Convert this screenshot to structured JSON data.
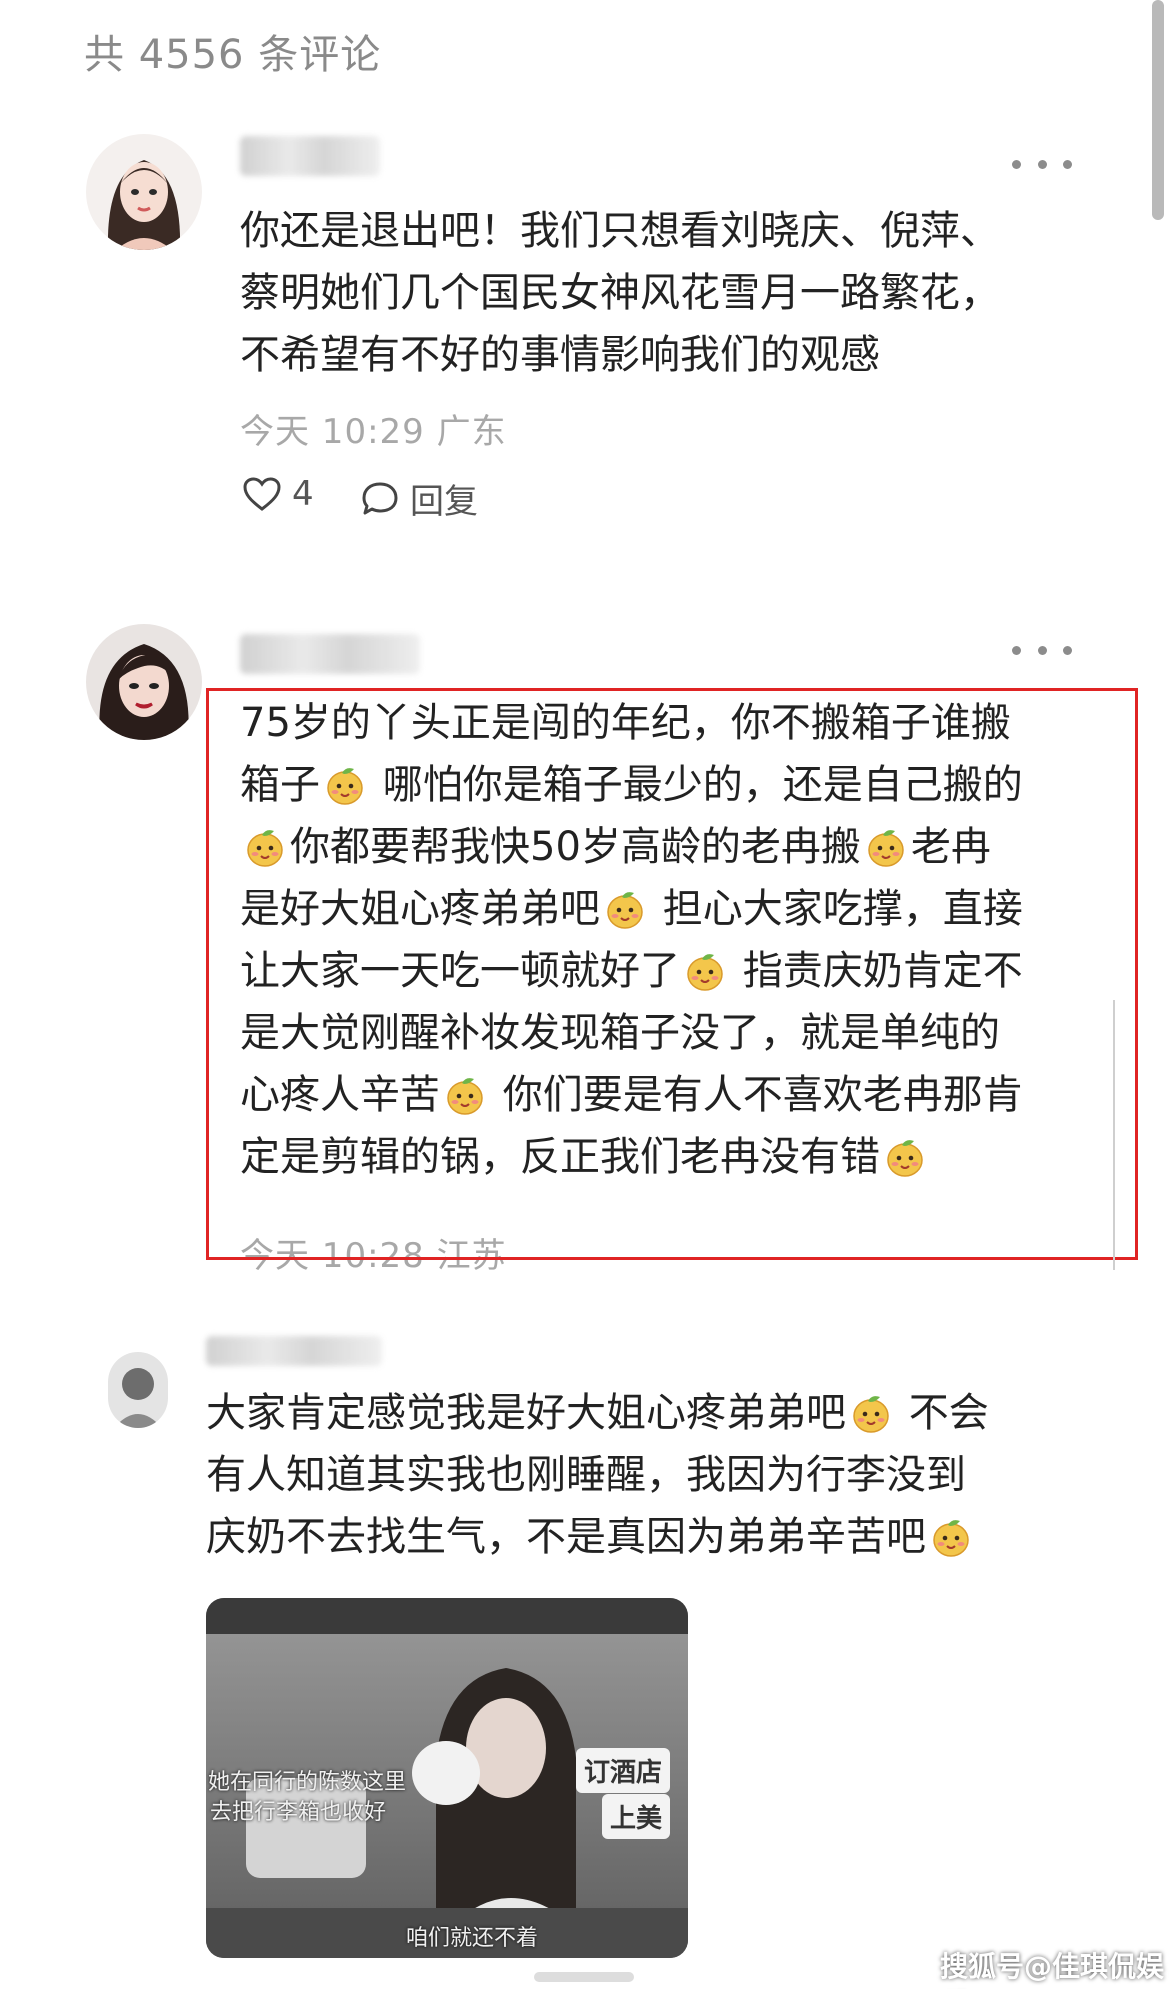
{
  "header": {
    "comment_count": "共 4556 条评论"
  },
  "comments": [
    {
      "text": "你还是退出吧！我们只想看刘晓庆、倪萍、蔡明她们几个国民女神风花雪月一路繁花，不希望有不好的事情影响我们的观感",
      "lines": [
        "你还是退出吧！我们只想看刘晓庆、倪萍、",
        "蔡明她们几个国民女神风花雪月一路繁花，",
        "不希望有不好的事情影响我们的观感"
      ],
      "time": "今天 10:29 广东",
      "likes": "4",
      "reply_label": "回复"
    },
    {
      "lines": [
        "75岁的丫头正是闯的年纪，你不搬箱子谁搬",
        "箱子",
        "哪怕你是箱子最少的，还是自己搬的",
        "你都要帮我快50岁高龄的老冉搬",
        "老冉",
        "是好大姐心疼弟弟吧",
        "担心大家吃撑，直接",
        "让大家一天吃一顿就好了",
        "指责庆奶肯定不",
        "是大觉刚醒补妆发现箱子没了，就是单纯的",
        "心疼人辛苦",
        "你们要是有人不喜欢老冉那肯",
        "定是剪辑的锅，反正我们老冉没有错"
      ],
      "time": "今天 10:28 江苏"
    },
    {
      "lines": [
        "大家肯定感觉我是好大姐心疼弟弟吧",
        "不会",
        "有人知道其实我也刚睡醒，我因为行李没到",
        "庆奶不去找生气，不是真因为弟弟辛苦吧"
      ],
      "image": {
        "subtitle_1": "她在同行的陈数这里",
        "subtitle_2": "去把行李箱也收好",
        "sign_1": "订酒店",
        "sign_2": "上美",
        "caption": "咱们就还不着"
      }
    }
  ],
  "watermark": "搜狐号@佳琪侃娱乐",
  "colors": {
    "highlight": "#e02424",
    "meta": "#a8a8a8",
    "text": "#222222"
  }
}
